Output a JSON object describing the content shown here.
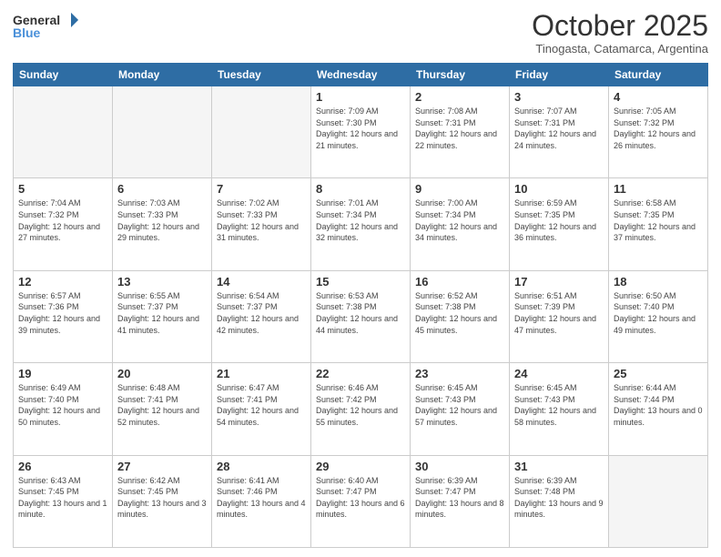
{
  "header": {
    "logo_general": "General",
    "logo_blue": "Blue",
    "month_title": "October 2025",
    "subtitle": "Tinogasta, Catamarca, Argentina"
  },
  "days_of_week": [
    "Sunday",
    "Monday",
    "Tuesday",
    "Wednesday",
    "Thursday",
    "Friday",
    "Saturday"
  ],
  "weeks": [
    [
      {
        "day": "",
        "empty": true
      },
      {
        "day": "",
        "empty": true
      },
      {
        "day": "",
        "empty": true
      },
      {
        "day": "1",
        "sunrise": "7:09 AM",
        "sunset": "7:30 PM",
        "daylight": "12 hours and 21 minutes."
      },
      {
        "day": "2",
        "sunrise": "7:08 AM",
        "sunset": "7:31 PM",
        "daylight": "12 hours and 22 minutes."
      },
      {
        "day": "3",
        "sunrise": "7:07 AM",
        "sunset": "7:31 PM",
        "daylight": "12 hours and 24 minutes."
      },
      {
        "day": "4",
        "sunrise": "7:05 AM",
        "sunset": "7:32 PM",
        "daylight": "12 hours and 26 minutes."
      }
    ],
    [
      {
        "day": "5",
        "sunrise": "7:04 AM",
        "sunset": "7:32 PM",
        "daylight": "12 hours and 27 minutes."
      },
      {
        "day": "6",
        "sunrise": "7:03 AM",
        "sunset": "7:33 PM",
        "daylight": "12 hours and 29 minutes."
      },
      {
        "day": "7",
        "sunrise": "7:02 AM",
        "sunset": "7:33 PM",
        "daylight": "12 hours and 31 minutes."
      },
      {
        "day": "8",
        "sunrise": "7:01 AM",
        "sunset": "7:34 PM",
        "daylight": "12 hours and 32 minutes."
      },
      {
        "day": "9",
        "sunrise": "7:00 AM",
        "sunset": "7:34 PM",
        "daylight": "12 hours and 34 minutes."
      },
      {
        "day": "10",
        "sunrise": "6:59 AM",
        "sunset": "7:35 PM",
        "daylight": "12 hours and 36 minutes."
      },
      {
        "day": "11",
        "sunrise": "6:58 AM",
        "sunset": "7:35 PM",
        "daylight": "12 hours and 37 minutes."
      }
    ],
    [
      {
        "day": "12",
        "sunrise": "6:57 AM",
        "sunset": "7:36 PM",
        "daylight": "12 hours and 39 minutes."
      },
      {
        "day": "13",
        "sunrise": "6:55 AM",
        "sunset": "7:37 PM",
        "daylight": "12 hours and 41 minutes."
      },
      {
        "day": "14",
        "sunrise": "6:54 AM",
        "sunset": "7:37 PM",
        "daylight": "12 hours and 42 minutes."
      },
      {
        "day": "15",
        "sunrise": "6:53 AM",
        "sunset": "7:38 PM",
        "daylight": "12 hours and 44 minutes."
      },
      {
        "day": "16",
        "sunrise": "6:52 AM",
        "sunset": "7:38 PM",
        "daylight": "12 hours and 45 minutes."
      },
      {
        "day": "17",
        "sunrise": "6:51 AM",
        "sunset": "7:39 PM",
        "daylight": "12 hours and 47 minutes."
      },
      {
        "day": "18",
        "sunrise": "6:50 AM",
        "sunset": "7:40 PM",
        "daylight": "12 hours and 49 minutes."
      }
    ],
    [
      {
        "day": "19",
        "sunrise": "6:49 AM",
        "sunset": "7:40 PM",
        "daylight": "12 hours and 50 minutes."
      },
      {
        "day": "20",
        "sunrise": "6:48 AM",
        "sunset": "7:41 PM",
        "daylight": "12 hours and 52 minutes."
      },
      {
        "day": "21",
        "sunrise": "6:47 AM",
        "sunset": "7:41 PM",
        "daylight": "12 hours and 54 minutes."
      },
      {
        "day": "22",
        "sunrise": "6:46 AM",
        "sunset": "7:42 PM",
        "daylight": "12 hours and 55 minutes."
      },
      {
        "day": "23",
        "sunrise": "6:45 AM",
        "sunset": "7:43 PM",
        "daylight": "12 hours and 57 minutes."
      },
      {
        "day": "24",
        "sunrise": "6:45 AM",
        "sunset": "7:43 PM",
        "daylight": "12 hours and 58 minutes."
      },
      {
        "day": "25",
        "sunrise": "6:44 AM",
        "sunset": "7:44 PM",
        "daylight": "13 hours and 0 minutes."
      }
    ],
    [
      {
        "day": "26",
        "sunrise": "6:43 AM",
        "sunset": "7:45 PM",
        "daylight": "13 hours and 1 minute."
      },
      {
        "day": "27",
        "sunrise": "6:42 AM",
        "sunset": "7:45 PM",
        "daylight": "13 hours and 3 minutes."
      },
      {
        "day": "28",
        "sunrise": "6:41 AM",
        "sunset": "7:46 PM",
        "daylight": "13 hours and 4 minutes."
      },
      {
        "day": "29",
        "sunrise": "6:40 AM",
        "sunset": "7:47 PM",
        "daylight": "13 hours and 6 minutes."
      },
      {
        "day": "30",
        "sunrise": "6:39 AM",
        "sunset": "7:47 PM",
        "daylight": "13 hours and 8 minutes."
      },
      {
        "day": "31",
        "sunrise": "6:39 AM",
        "sunset": "7:48 PM",
        "daylight": "13 hours and 9 minutes."
      },
      {
        "day": "",
        "empty": true
      }
    ]
  ]
}
